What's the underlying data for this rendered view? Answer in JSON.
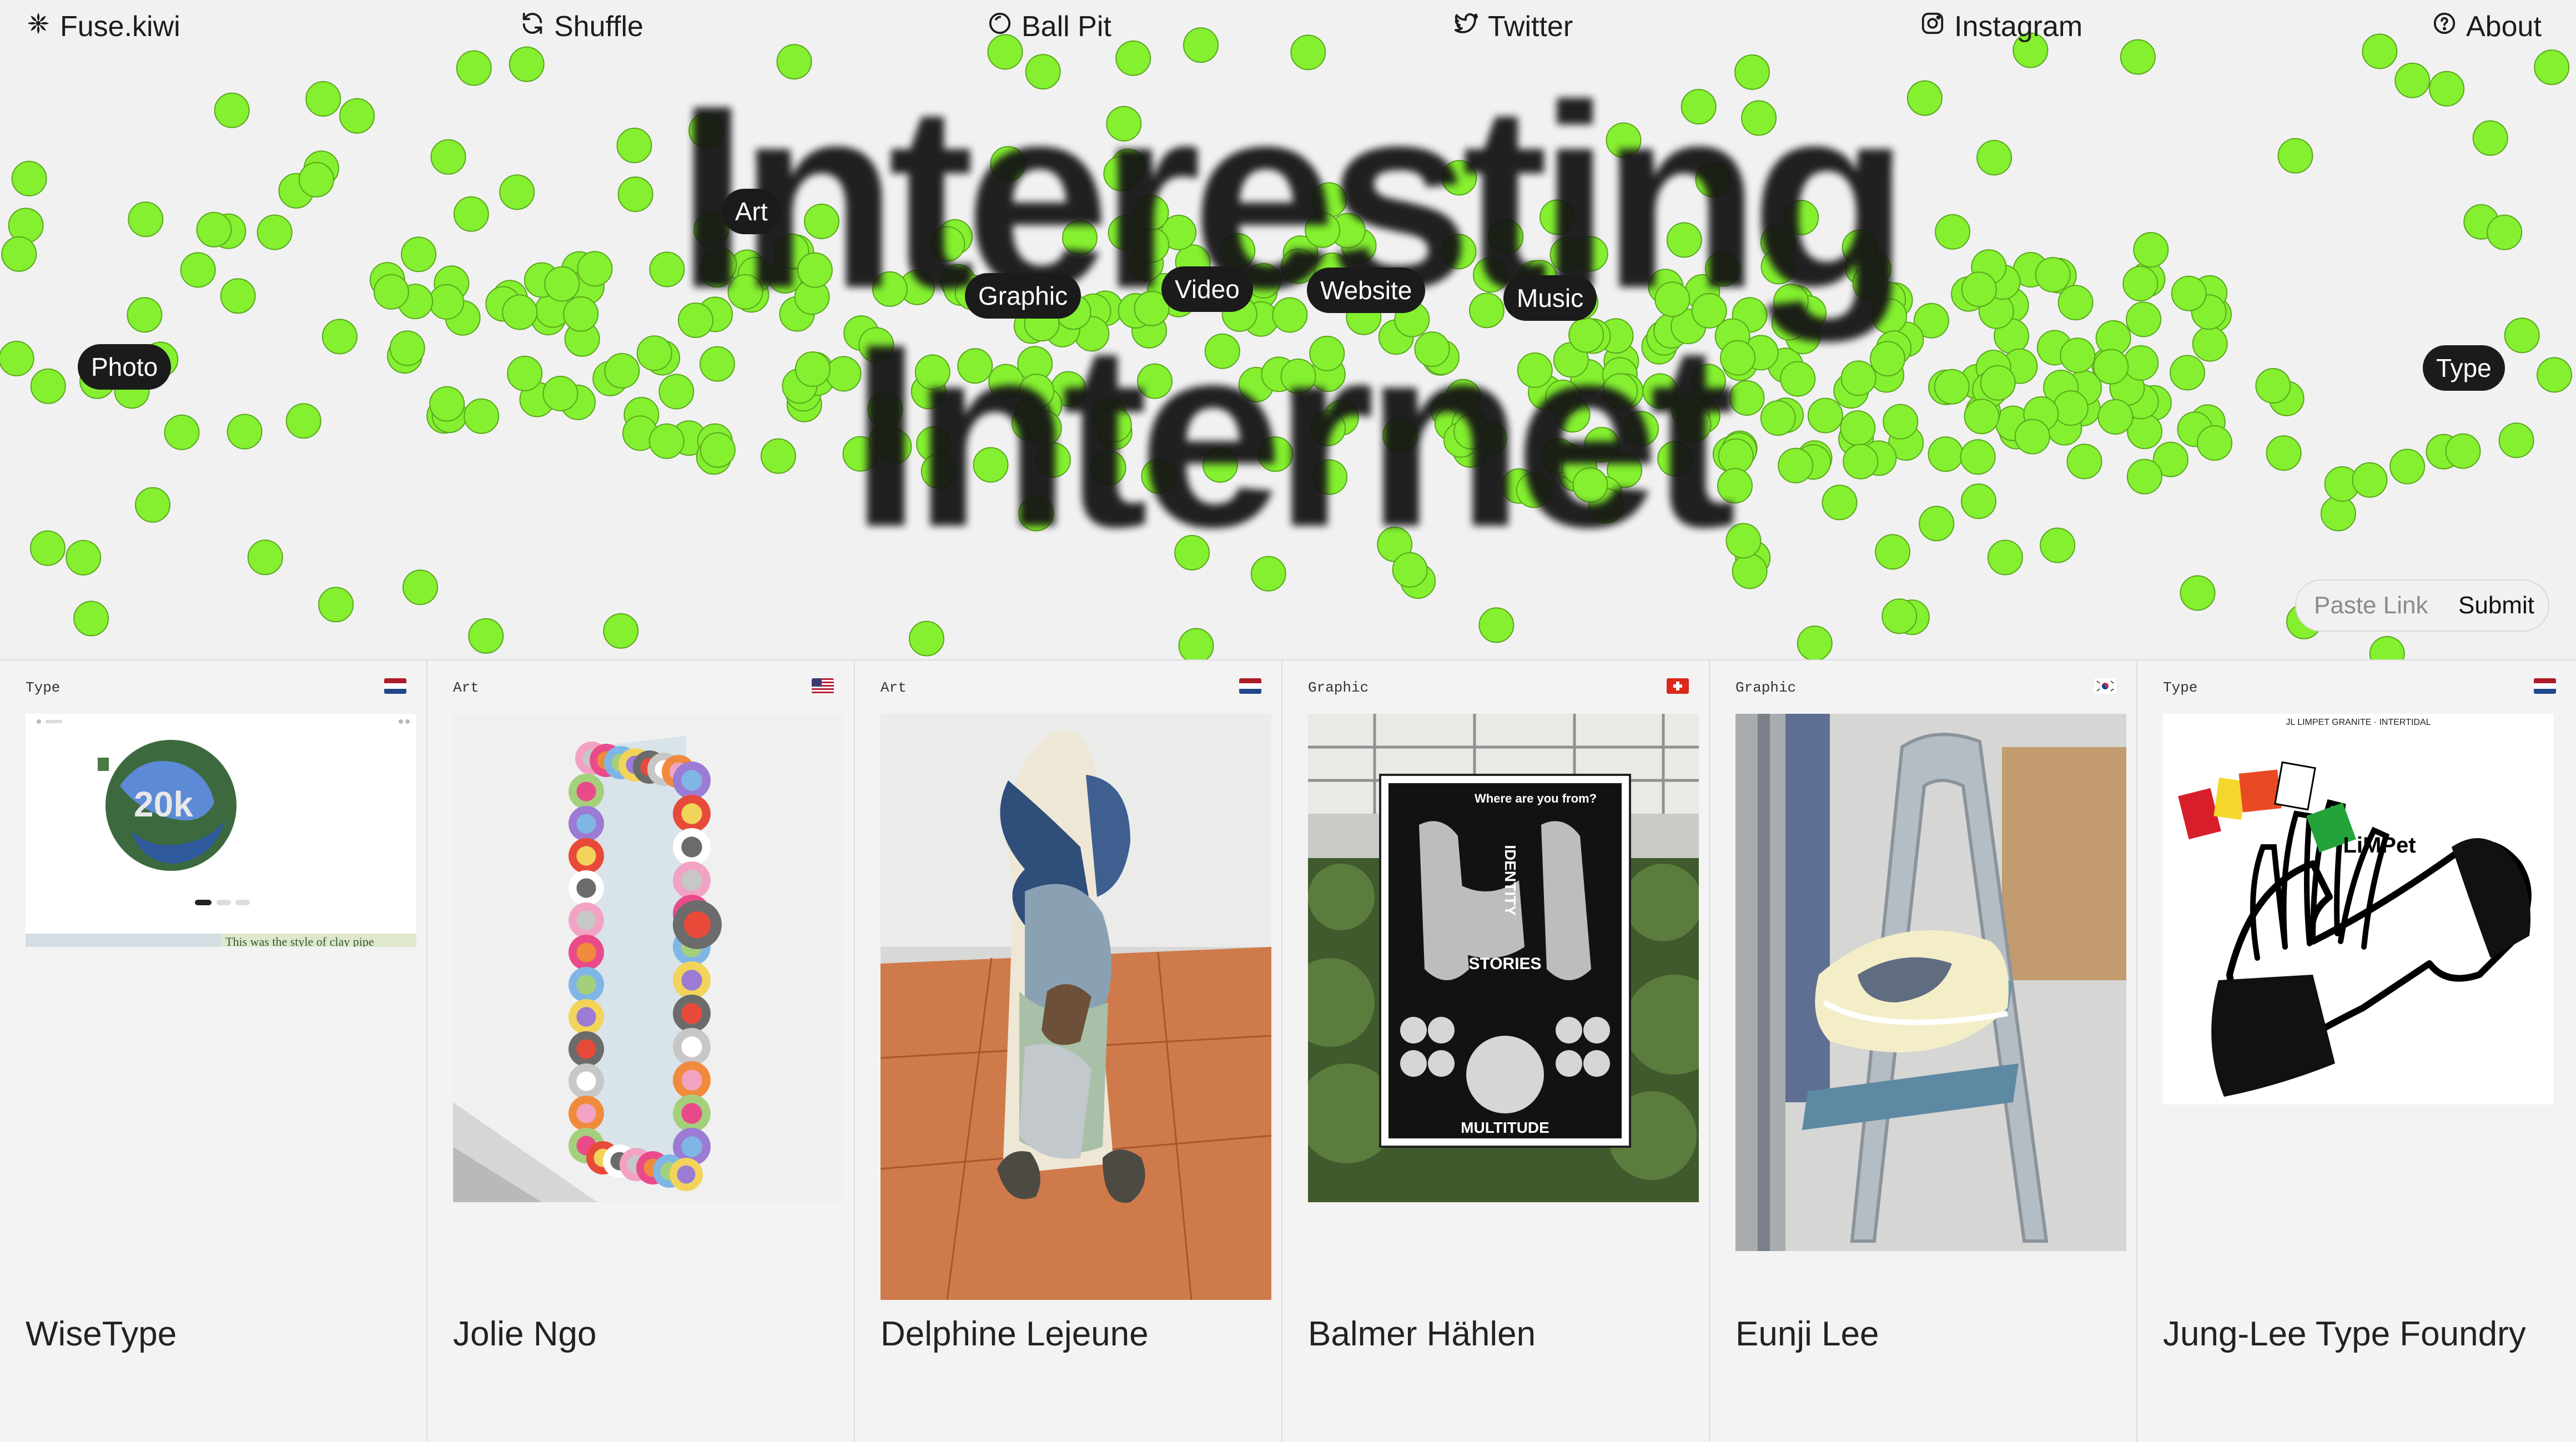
{
  "nav": {
    "logo": "Fuse.kiwi",
    "shuffle": "Shuffle",
    "ball_pit": "Ball Pit",
    "twitter": "Twitter",
    "instagram": "Instagram",
    "about": "About"
  },
  "hero": {
    "headline_line1": "Interesting",
    "headline_line2": "Internet",
    "ball_color": "#84f02f",
    "tags": [
      "Art",
      "Graphic",
      "Video",
      "Website",
      "Music",
      "Photo",
      "Type"
    ],
    "paste_placeholder": "Paste Link",
    "submit_label": "Submit"
  },
  "cards": [
    {
      "category": "Type",
      "flag": "nl",
      "title": "WiseType",
      "caption": "This was the style of clay pipe"
    },
    {
      "category": "Art",
      "flag": "us",
      "title": "Jolie Ngo"
    },
    {
      "category": "Art",
      "flag": "nl",
      "title": "Delphine Lejeune"
    },
    {
      "category": "Graphic",
      "flag": "ch",
      "title": "Balmer Hählen",
      "poster_words": [
        "IDENTITY",
        "STORIES",
        "MULTITUDE",
        "Where are you from?"
      ]
    },
    {
      "category": "Graphic",
      "flag": "kr",
      "title": "Eunji Lee"
    },
    {
      "category": "Type",
      "flag": "nl",
      "title": "Jung-Lee Type Foundry",
      "poster_header": "JL LIMPET GRANITE · INTERTIDAL",
      "poster_word": "LiMPet"
    }
  ]
}
